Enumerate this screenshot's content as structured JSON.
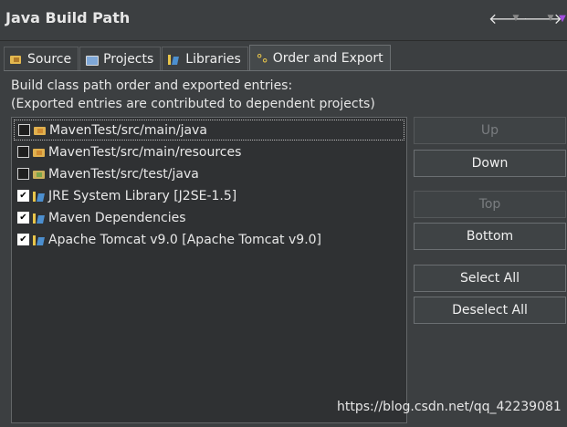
{
  "window": {
    "title": "Java Build Path"
  },
  "tabs": [
    {
      "label": "Source",
      "icon": "source-folder-icon",
      "active": false
    },
    {
      "label": "Projects",
      "icon": "projects-icon",
      "active": false
    },
    {
      "label": "Libraries",
      "icon": "libraries-icon",
      "active": false
    },
    {
      "label": "Order and Export",
      "icon": "order-export-icon",
      "active": true
    }
  ],
  "description": {
    "line1": "Build class path order and exported entries:",
    "line2": "(Exported entries are contributed to dependent projects)"
  },
  "entries": [
    {
      "label": "MavenTest/src/main/java",
      "checked": false,
      "icon": "source-folder-icon",
      "selected": true
    },
    {
      "label": "MavenTest/src/main/resources",
      "checked": false,
      "icon": "source-folder-icon",
      "selected": false
    },
    {
      "label": "MavenTest/src/test/java",
      "checked": false,
      "icon": "test-source-folder-icon",
      "selected": false
    },
    {
      "label": "JRE System Library [J2SE-1.5]",
      "checked": true,
      "icon": "library-icon",
      "selected": false
    },
    {
      "label": "Maven Dependencies",
      "checked": true,
      "icon": "library-icon",
      "selected": false
    },
    {
      "label": "Apache Tomcat v9.0 [Apache Tomcat v9.0]",
      "checked": true,
      "icon": "library-icon",
      "selected": false
    }
  ],
  "buttons": {
    "up": {
      "label": "Up",
      "enabled": false
    },
    "down": {
      "label": "Down",
      "enabled": true
    },
    "top": {
      "label": "Top",
      "enabled": false
    },
    "bottom": {
      "label": "Bottom",
      "enabled": true
    },
    "select_all": {
      "label": "Select All",
      "enabled": true
    },
    "deselect_all": {
      "label": "Deselect All",
      "enabled": true
    }
  },
  "watermark": "https://blog.csdn.net/qq_42239081",
  "colors": {
    "background": "#3c3f41",
    "list_background": "#2f3133",
    "text": "#e8e8e8",
    "disabled_text": "#7a7d80"
  }
}
